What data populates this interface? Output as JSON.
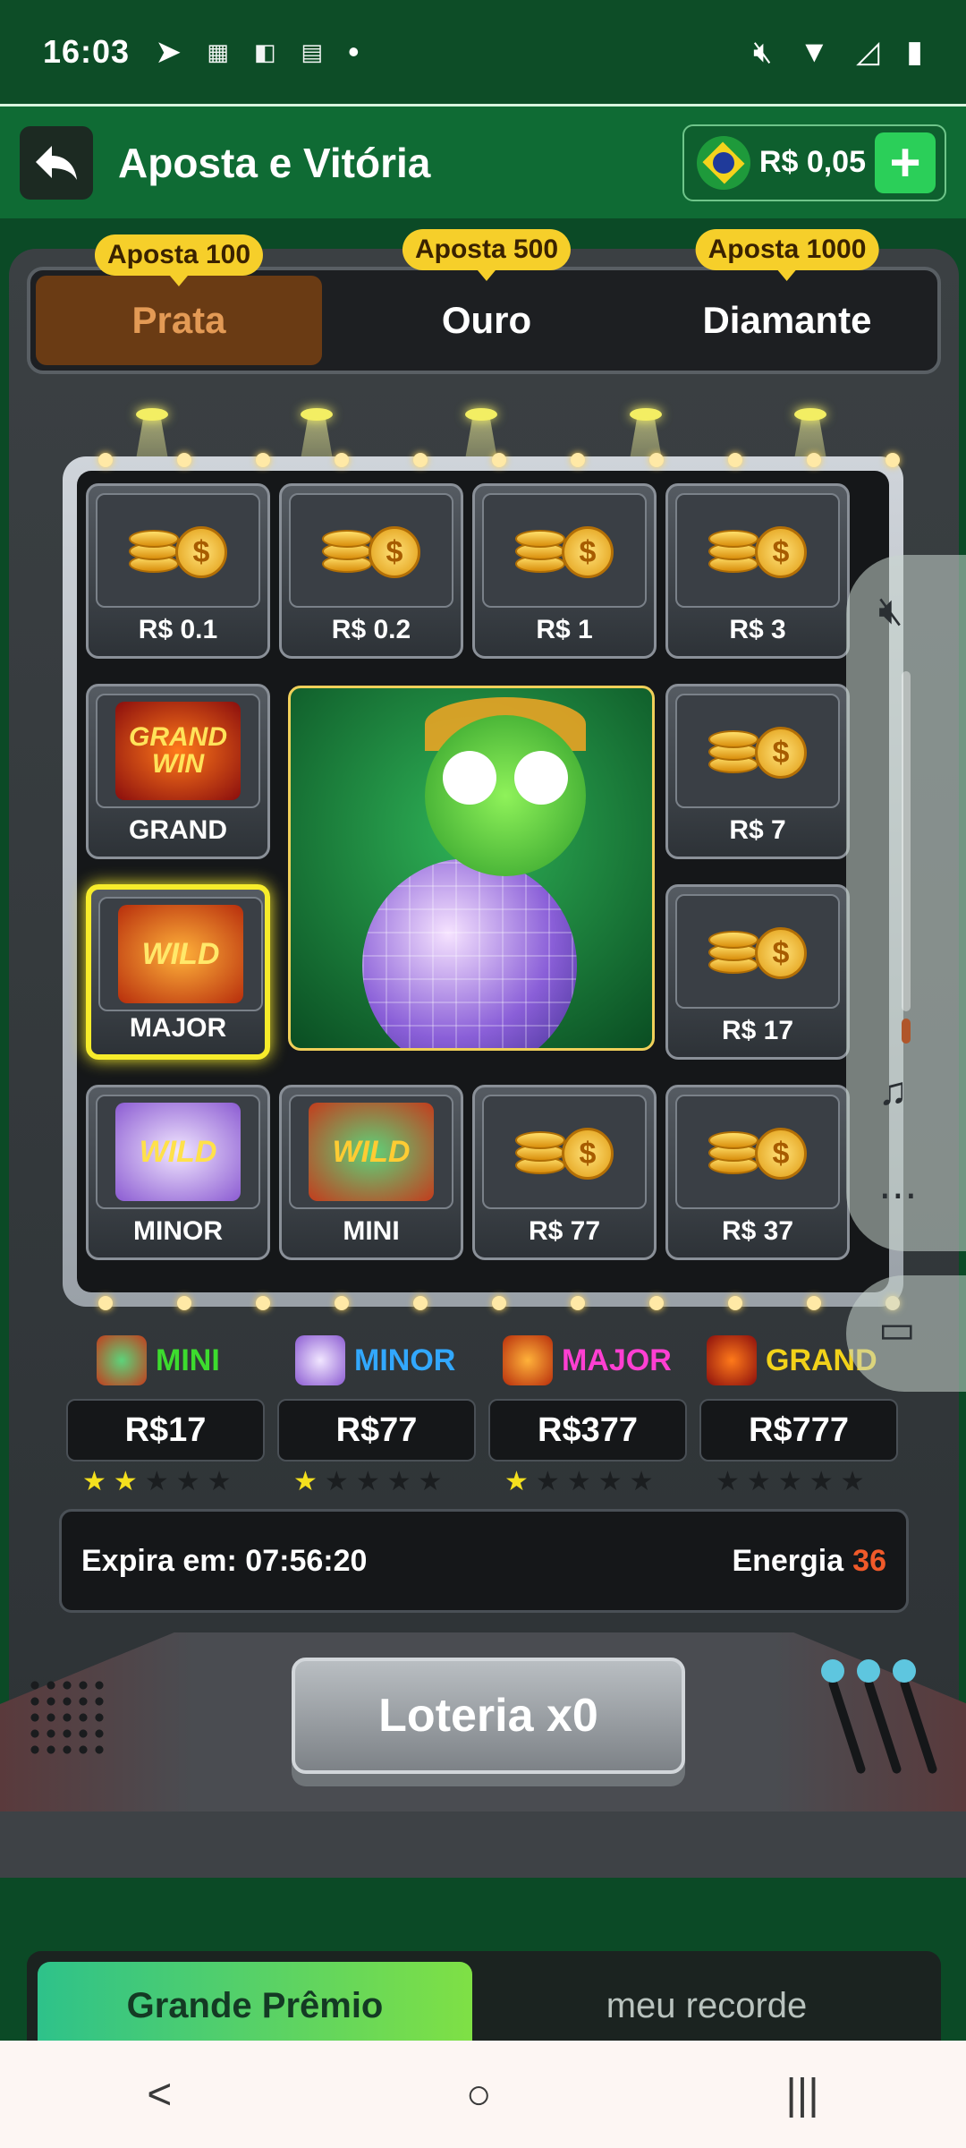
{
  "status_bar": {
    "time": "16:03",
    "icons": [
      "telegram-icon",
      "temu-icon",
      "app-icon",
      "pdf-icon",
      "dot-icon"
    ],
    "right_icons": [
      "mute-icon",
      "wifi-icon",
      "signal-icon",
      "battery-icon"
    ]
  },
  "header": {
    "title": "Aposta e Vitória",
    "balance": "R$ 0,05",
    "plus": "+"
  },
  "tiers": [
    {
      "badge": "Aposta 100",
      "label": "Prata",
      "active": true
    },
    {
      "badge": "Aposta 500",
      "label": "Ouro",
      "active": false
    },
    {
      "badge": "Aposta 1000",
      "label": "Diamante",
      "active": false
    }
  ],
  "grid": {
    "cells": [
      {
        "label": "R$ 0.1",
        "art": "coins"
      },
      {
        "label": "R$ 0.2",
        "art": "coins"
      },
      {
        "label": "R$ 1",
        "art": "coins"
      },
      {
        "label": "R$ 3",
        "art": "coins"
      },
      {
        "label": "GRAND",
        "art": "grand-win"
      },
      {
        "label": "R$ 7",
        "art": "coins"
      },
      {
        "label": "MAJOR",
        "art": "wild-tiger",
        "highlighted": true
      },
      {
        "label": "R$ 17",
        "art": "coins"
      },
      {
        "label": "MINOR",
        "art": "wild-rabbit"
      },
      {
        "label": "MINI",
        "art": "wild-dragon"
      },
      {
        "label": "R$ 77",
        "art": "coins"
      },
      {
        "label": "R$ 37",
        "art": "coins"
      }
    ],
    "grand_art_text": "GRAND WIN",
    "wild_text": "WILD",
    "coin_symbol": "$"
  },
  "jackpots": [
    {
      "name": "MINI",
      "value": "R$17",
      "stars_on": 2,
      "stars_total": 5,
      "color": "#3ddc2e"
    },
    {
      "name": "MINOR",
      "value": "R$77",
      "stars_on": 1,
      "stars_total": 5,
      "color": "#32a8ff"
    },
    {
      "name": "MAJOR",
      "value": "R$377",
      "stars_on": 1,
      "stars_total": 5,
      "color": "#ff3fd2"
    },
    {
      "name": "GRAND",
      "value": "R$777",
      "stars_on": 0,
      "stars_total": 5,
      "color": "#f2d21a"
    }
  ],
  "info": {
    "expires_label": "Expira em: 07:56:20",
    "energy_label": "Energia",
    "energy_value": "36"
  },
  "lottery_button": "Loteria x0",
  "bottom_tabs": {
    "active": "Grande Prêmio",
    "inactive": "meu recorde"
  },
  "navbar": {
    "back": "<",
    "home": "○",
    "recents": "|||"
  },
  "colors": {
    "background": "#0b4a26",
    "header": "#0f6b34",
    "accent_yellow": "#f6cf2a",
    "energy": "#f05a2a"
  }
}
